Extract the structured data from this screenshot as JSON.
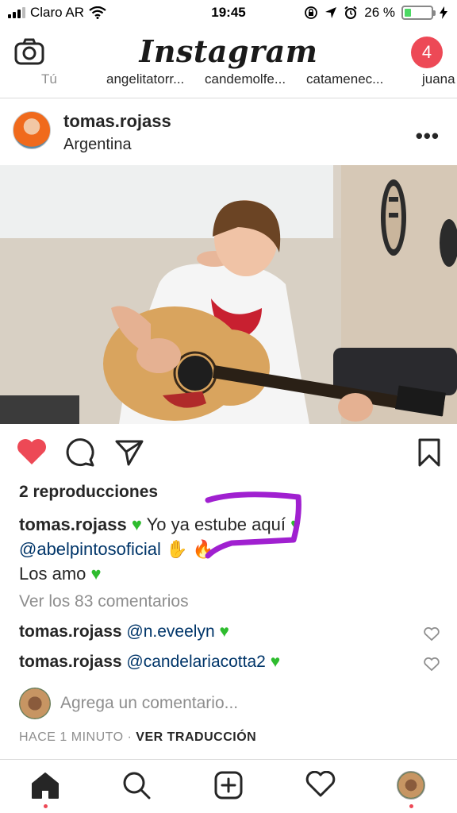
{
  "status_bar": {
    "carrier": "Claro AR",
    "time": "19:45",
    "battery_percent": "26 %",
    "battery_level": 0.26
  },
  "header": {
    "title": "Instagram",
    "notification_count": "4"
  },
  "stories": [
    "Tú",
    "angelitatorr...",
    "candemolfe...",
    "catamenec...",
    "juana"
  ],
  "post": {
    "username": "tomas.rojass",
    "location": "Argentina",
    "plays": "2 reproducciones",
    "caption_user": "tomas.rojass",
    "caption_text_1": "Yo ya estube aquí",
    "caption_mention": "@abelpintosoficial",
    "caption_text_2": "Los amo",
    "view_comments": "Ver los 83 comentarios",
    "comments": [
      {
        "user": "tomas.rojass",
        "text": "@n.eveelyn"
      },
      {
        "user": "tomas.rojass",
        "text": "@candelariacotta2"
      }
    ],
    "add_comment_placeholder": "Agrega un comentario...",
    "time_ago": "HACE 1 MINUTO",
    "translate": "VER TRADUCCIÓN"
  },
  "colors": {
    "like_red": "#ed4956",
    "green_heart": "#2ebc2e",
    "annotation_purple": "#a020d0",
    "mention_blue": "#003569"
  },
  "icons": [
    "camera-icon",
    "more-icon",
    "heart-icon",
    "comment-icon",
    "share-icon",
    "bookmark-icon",
    "home-icon",
    "search-icon",
    "add-icon",
    "activity-icon"
  ]
}
